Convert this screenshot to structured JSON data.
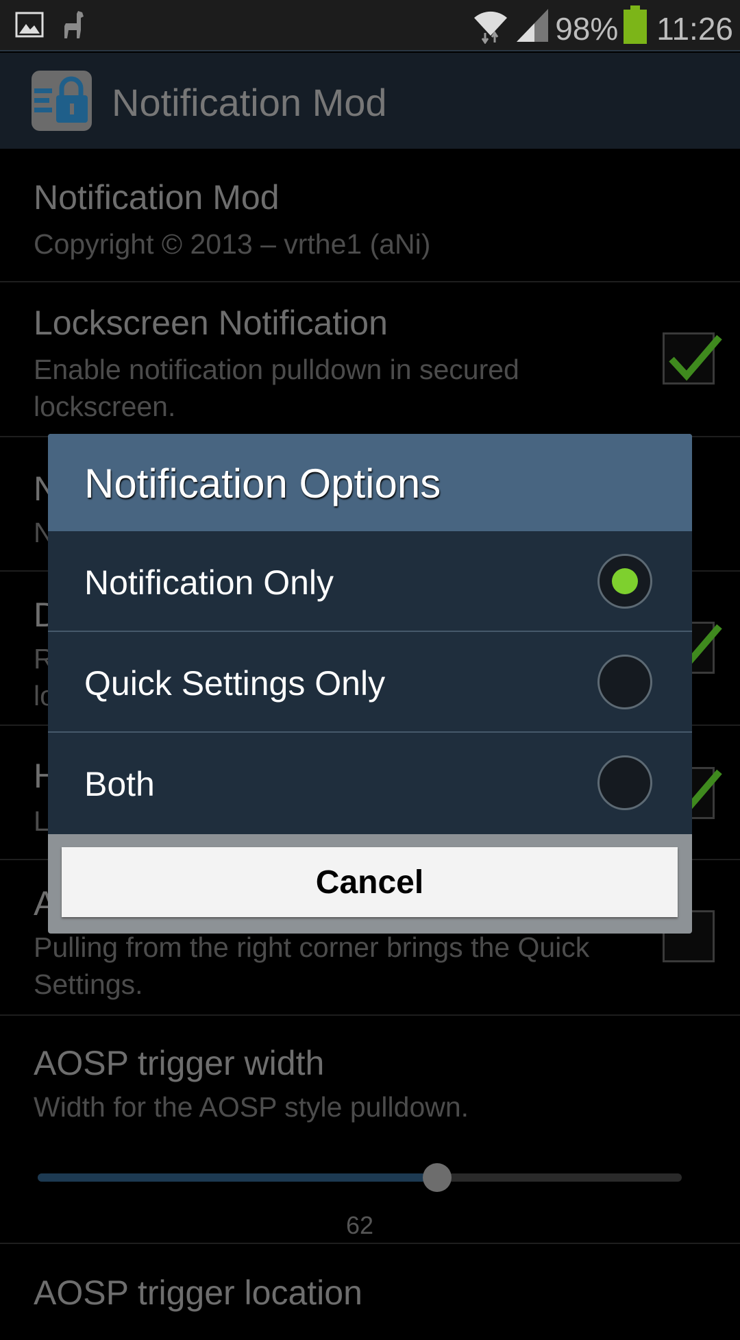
{
  "status_bar": {
    "battery": "98%",
    "time": "11:26",
    "icons": [
      "gallery-icon",
      "llama-icon",
      "wifi-icon",
      "signal-icon",
      "battery-icon"
    ],
    "battery_color": "#7cb518"
  },
  "app_bar": {
    "title": "Notification Mod"
  },
  "preferences": [
    {
      "title": "Notification Mod",
      "summary": "Copyright © 2013 – vrthe1 (aNi)"
    },
    {
      "title": "Lockscreen Notification",
      "summary": "Enable notification pulldown in secured lockscreen.",
      "checked": true
    },
    {
      "title": "N",
      "summary": "N"
    },
    {
      "title": "D",
      "summary": "R\nlo",
      "checked": true
    },
    {
      "title": "H",
      "summary": "L",
      "checked": true
    },
    {
      "title": "A",
      "summary": "Pulling from the right corner brings the Quick Settings.",
      "checked": false
    },
    {
      "title": "AOSP trigger width",
      "summary": "Width for the AOSP style pulldown.",
      "slider_value": "62",
      "slider_percent": 62
    },
    {
      "title": "AOSP trigger location"
    }
  ],
  "dialog": {
    "title": "Notification Options",
    "options": [
      {
        "label": "Notification Only",
        "selected": true
      },
      {
        "label": "Quick Settings Only",
        "selected": false
      },
      {
        "label": "Both",
        "selected": false
      }
    ],
    "cancel_label": "Cancel",
    "accent": "#7ed02e"
  }
}
